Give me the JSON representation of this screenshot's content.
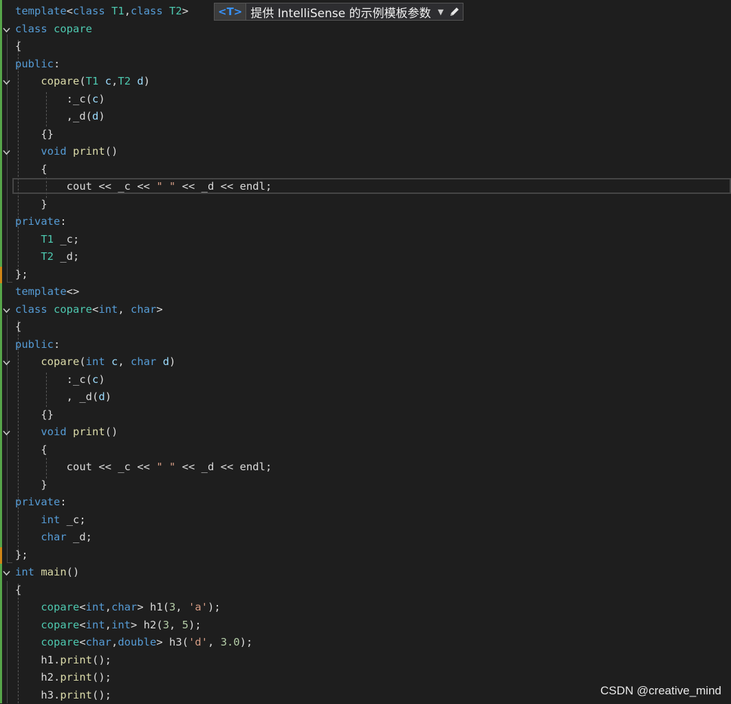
{
  "watermark": "CSDN @creative_mind",
  "intellisense_hint": {
    "tag": "<T>",
    "text": "提供 IntelliSense 的示例模板参数",
    "dropdown_icon": "caret-down-icon",
    "edit_icon": "pencil-icon"
  },
  "colors": {
    "background": "#1e1e1e",
    "keyword": "#569cd6",
    "type": "#4ec9b0",
    "function": "#dcdcaa",
    "string": "#d69d85",
    "number": "#b5cea8",
    "change_bar_saved": "#57a64a",
    "change_bar_unsaved": "#d18616"
  },
  "lines": [
    {
      "tokens": [
        {
          "t": "template",
          "c": "kw"
        },
        {
          "t": "<",
          "c": "pl"
        },
        {
          "t": "class",
          "c": "kw"
        },
        {
          "t": " ",
          "c": "pl"
        },
        {
          "t": "T1",
          "c": "ty"
        },
        {
          "t": ",",
          "c": "pl"
        },
        {
          "t": "class",
          "c": "kw"
        },
        {
          "t": " ",
          "c": "pl"
        },
        {
          "t": "T2",
          "c": "ty"
        },
        {
          "t": ">",
          "c": "pl"
        }
      ]
    },
    {
      "fold": true,
      "tokens": [
        {
          "t": "class",
          "c": "kw"
        },
        {
          "t": " ",
          "c": "pl"
        },
        {
          "t": "copare",
          "c": "ty"
        }
      ]
    },
    {
      "tokens": [
        {
          "t": "{",
          "c": "pl"
        }
      ]
    },
    {
      "tokens": [
        {
          "t": "public",
          "c": "kw"
        },
        {
          "t": ":",
          "c": "pl"
        }
      ]
    },
    {
      "fold": true,
      "tokens": [
        {
          "t": "    ",
          "c": "pl"
        },
        {
          "t": "copare",
          "c": "fn"
        },
        {
          "t": "(",
          "c": "pl"
        },
        {
          "t": "T1",
          "c": "ty"
        },
        {
          "t": " ",
          "c": "pl"
        },
        {
          "t": "c",
          "c": "pm"
        },
        {
          "t": ",",
          "c": "pl"
        },
        {
          "t": "T2",
          "c": "ty"
        },
        {
          "t": " ",
          "c": "pl"
        },
        {
          "t": "d",
          "c": "pm"
        },
        {
          "t": ")",
          "c": "pl"
        }
      ]
    },
    {
      "tokens": [
        {
          "t": "        ",
          "c": "pl"
        },
        {
          "t": ":",
          "c": "pl"
        },
        {
          "t": "_c",
          "c": "fd"
        },
        {
          "t": "(",
          "c": "pl"
        },
        {
          "t": "c",
          "c": "pm"
        },
        {
          "t": ")",
          "c": "pl"
        }
      ]
    },
    {
      "tokens": [
        {
          "t": "        ",
          "c": "pl"
        },
        {
          "t": ",",
          "c": "pl"
        },
        {
          "t": "_d",
          "c": "fd"
        },
        {
          "t": "(",
          "c": "pl"
        },
        {
          "t": "d",
          "c": "pm"
        },
        {
          "t": ")",
          "c": "pl"
        }
      ]
    },
    {
      "tokens": [
        {
          "t": "    ",
          "c": "pl"
        },
        {
          "t": "{}",
          "c": "pl"
        }
      ]
    },
    {
      "fold": true,
      "tokens": [
        {
          "t": "    ",
          "c": "pl"
        },
        {
          "t": "void",
          "c": "kw"
        },
        {
          "t": " ",
          "c": "pl"
        },
        {
          "t": "print",
          "c": "fn"
        },
        {
          "t": "()",
          "c": "pl"
        }
      ]
    },
    {
      "tokens": [
        {
          "t": "    ",
          "c": "pl"
        },
        {
          "t": "{",
          "c": "pl"
        }
      ]
    },
    {
      "tokens": [
        {
          "t": "        ",
          "c": "pl"
        },
        {
          "t": "cout",
          "c": "pl"
        },
        {
          "t": " << ",
          "c": "pl"
        },
        {
          "t": "_c",
          "c": "fd"
        },
        {
          "t": " << ",
          "c": "pl"
        },
        {
          "t": "\" \"",
          "c": "st"
        },
        {
          "t": " << ",
          "c": "pl"
        },
        {
          "t": "_d",
          "c": "fd"
        },
        {
          "t": " << ",
          "c": "pl"
        },
        {
          "t": "endl",
          "c": "pl"
        },
        {
          "t": ";",
          "c": "pl"
        }
      ]
    },
    {
      "tokens": [
        {
          "t": "    ",
          "c": "pl"
        },
        {
          "t": "}",
          "c": "pl"
        }
      ]
    },
    {
      "tokens": [
        {
          "t": "private",
          "c": "kw"
        },
        {
          "t": ":",
          "c": "pl"
        }
      ]
    },
    {
      "tokens": [
        {
          "t": "    ",
          "c": "pl"
        },
        {
          "t": "T1",
          "c": "ty"
        },
        {
          "t": " ",
          "c": "pl"
        },
        {
          "t": "_c",
          "c": "fd"
        },
        {
          "t": ";",
          "c": "pl"
        }
      ]
    },
    {
      "tokens": [
        {
          "t": "    ",
          "c": "pl"
        },
        {
          "t": "T2",
          "c": "ty"
        },
        {
          "t": " ",
          "c": "pl"
        },
        {
          "t": "_d",
          "c": "fd"
        },
        {
          "t": ";",
          "c": "pl"
        }
      ]
    },
    {
      "tokens": [
        {
          "t": "};",
          "c": "pl"
        }
      ]
    },
    {
      "tokens": [
        {
          "t": "template",
          "c": "kw"
        },
        {
          "t": "<>",
          "c": "pl"
        }
      ]
    },
    {
      "fold": true,
      "tokens": [
        {
          "t": "class",
          "c": "kw"
        },
        {
          "t": " ",
          "c": "pl"
        },
        {
          "t": "copare",
          "c": "ty"
        },
        {
          "t": "<",
          "c": "pl"
        },
        {
          "t": "int",
          "c": "kw"
        },
        {
          "t": ", ",
          "c": "pl"
        },
        {
          "t": "char",
          "c": "kw"
        },
        {
          "t": ">",
          "c": "pl"
        }
      ]
    },
    {
      "tokens": [
        {
          "t": "{",
          "c": "pl"
        }
      ]
    },
    {
      "tokens": [
        {
          "t": "public",
          "c": "kw"
        },
        {
          "t": ":",
          "c": "pl"
        }
      ]
    },
    {
      "fold": true,
      "tokens": [
        {
          "t": "    ",
          "c": "pl"
        },
        {
          "t": "copare",
          "c": "fn"
        },
        {
          "t": "(",
          "c": "pl"
        },
        {
          "t": "int",
          "c": "kw"
        },
        {
          "t": " ",
          "c": "pl"
        },
        {
          "t": "c",
          "c": "pm"
        },
        {
          "t": ", ",
          "c": "pl"
        },
        {
          "t": "char",
          "c": "kw"
        },
        {
          "t": " ",
          "c": "pl"
        },
        {
          "t": "d",
          "c": "pm"
        },
        {
          "t": ")",
          "c": "pl"
        }
      ]
    },
    {
      "tokens": [
        {
          "t": "        ",
          "c": "pl"
        },
        {
          "t": ":",
          "c": "pl"
        },
        {
          "t": "_c",
          "c": "fd"
        },
        {
          "t": "(",
          "c": "pl"
        },
        {
          "t": "c",
          "c": "pm"
        },
        {
          "t": ")",
          "c": "pl"
        }
      ]
    },
    {
      "tokens": [
        {
          "t": "        ",
          "c": "pl"
        },
        {
          "t": ", ",
          "c": "pl"
        },
        {
          "t": "_d",
          "c": "fd"
        },
        {
          "t": "(",
          "c": "pl"
        },
        {
          "t": "d",
          "c": "pm"
        },
        {
          "t": ")",
          "c": "pl"
        }
      ]
    },
    {
      "tokens": [
        {
          "t": "    ",
          "c": "pl"
        },
        {
          "t": "{}",
          "c": "pl"
        }
      ]
    },
    {
      "fold": true,
      "tokens": [
        {
          "t": "    ",
          "c": "pl"
        },
        {
          "t": "void",
          "c": "kw"
        },
        {
          "t": " ",
          "c": "pl"
        },
        {
          "t": "print",
          "c": "fn"
        },
        {
          "t": "()",
          "c": "pl"
        }
      ]
    },
    {
      "tokens": [
        {
          "t": "    ",
          "c": "pl"
        },
        {
          "t": "{",
          "c": "pl"
        }
      ]
    },
    {
      "tokens": [
        {
          "t": "        ",
          "c": "pl"
        },
        {
          "t": "cout",
          "c": "pl"
        },
        {
          "t": " << ",
          "c": "pl"
        },
        {
          "t": "_c",
          "c": "fd"
        },
        {
          "t": " << ",
          "c": "pl"
        },
        {
          "t": "\" \"",
          "c": "st"
        },
        {
          "t": " << ",
          "c": "pl"
        },
        {
          "t": "_d",
          "c": "fd"
        },
        {
          "t": " << ",
          "c": "pl"
        },
        {
          "t": "endl",
          "c": "pl"
        },
        {
          "t": ";",
          "c": "pl"
        }
      ]
    },
    {
      "tokens": [
        {
          "t": "    ",
          "c": "pl"
        },
        {
          "t": "}",
          "c": "pl"
        }
      ]
    },
    {
      "tokens": [
        {
          "t": "private",
          "c": "kw"
        },
        {
          "t": ":",
          "c": "pl"
        }
      ]
    },
    {
      "tokens": [
        {
          "t": "    ",
          "c": "pl"
        },
        {
          "t": "int",
          "c": "kw"
        },
        {
          "t": " ",
          "c": "pl"
        },
        {
          "t": "_c",
          "c": "fd"
        },
        {
          "t": ";",
          "c": "pl"
        }
      ]
    },
    {
      "tokens": [
        {
          "t": "    ",
          "c": "pl"
        },
        {
          "t": "char",
          "c": "kw"
        },
        {
          "t": " ",
          "c": "pl"
        },
        {
          "t": "_d",
          "c": "fd"
        },
        {
          "t": ";",
          "c": "pl"
        }
      ]
    },
    {
      "tokens": [
        {
          "t": "};",
          "c": "pl"
        }
      ]
    },
    {
      "fold": true,
      "tokens": [
        {
          "t": "int",
          "c": "kw"
        },
        {
          "t": " ",
          "c": "pl"
        },
        {
          "t": "main",
          "c": "fn"
        },
        {
          "t": "()",
          "c": "pl"
        }
      ]
    },
    {
      "tokens": [
        {
          "t": "{",
          "c": "pl"
        }
      ]
    },
    {
      "tokens": [
        {
          "t": "    ",
          "c": "pl"
        },
        {
          "t": "copare",
          "c": "ty"
        },
        {
          "t": "<",
          "c": "pl"
        },
        {
          "t": "int",
          "c": "kw"
        },
        {
          "t": ",",
          "c": "pl"
        },
        {
          "t": "char",
          "c": "kw"
        },
        {
          "t": ">",
          "c": "pl"
        },
        {
          "t": " h1",
          "c": "pl"
        },
        {
          "t": "(",
          "c": "pl"
        },
        {
          "t": "3",
          "c": "nu"
        },
        {
          "t": ", ",
          "c": "pl"
        },
        {
          "t": "'a'",
          "c": "st"
        },
        {
          "t": ");",
          "c": "pl"
        }
      ]
    },
    {
      "tokens": [
        {
          "t": "    ",
          "c": "pl"
        },
        {
          "t": "copare",
          "c": "ty"
        },
        {
          "t": "<",
          "c": "pl"
        },
        {
          "t": "int",
          "c": "kw"
        },
        {
          "t": ",",
          "c": "pl"
        },
        {
          "t": "int",
          "c": "kw"
        },
        {
          "t": ">",
          "c": "pl"
        },
        {
          "t": " h2",
          "c": "pl"
        },
        {
          "t": "(",
          "c": "pl"
        },
        {
          "t": "3",
          "c": "nu"
        },
        {
          "t": ", ",
          "c": "pl"
        },
        {
          "t": "5",
          "c": "nu"
        },
        {
          "t": ");",
          "c": "pl"
        }
      ]
    },
    {
      "tokens": [
        {
          "t": "    ",
          "c": "pl"
        },
        {
          "t": "copare",
          "c": "ty"
        },
        {
          "t": "<",
          "c": "pl"
        },
        {
          "t": "char",
          "c": "kw"
        },
        {
          "t": ",",
          "c": "pl"
        },
        {
          "t": "double",
          "c": "kw"
        },
        {
          "t": ">",
          "c": "pl"
        },
        {
          "t": " h3",
          "c": "pl"
        },
        {
          "t": "(",
          "c": "pl"
        },
        {
          "t": "'d'",
          "c": "st"
        },
        {
          "t": ", ",
          "c": "pl"
        },
        {
          "t": "3.0",
          "c": "nu"
        },
        {
          "t": ");",
          "c": "pl"
        }
      ]
    },
    {
      "tokens": [
        {
          "t": "    ",
          "c": "pl"
        },
        {
          "t": "h1",
          "c": "pl"
        },
        {
          "t": ".",
          "c": "pl"
        },
        {
          "t": "print",
          "c": "fn"
        },
        {
          "t": "();",
          "c": "pl"
        }
      ]
    },
    {
      "tokens": [
        {
          "t": "    ",
          "c": "pl"
        },
        {
          "t": "h2",
          "c": "pl"
        },
        {
          "t": ".",
          "c": "pl"
        },
        {
          "t": "print",
          "c": "fn"
        },
        {
          "t": "();",
          "c": "pl"
        }
      ]
    },
    {
      "tokens": [
        {
          "t": "    ",
          "c": "pl"
        },
        {
          "t": "h3",
          "c": "pl"
        },
        {
          "t": ".",
          "c": "pl"
        },
        {
          "t": "print",
          "c": "fn"
        },
        {
          "t": "();",
          "c": "pl"
        }
      ]
    }
  ]
}
